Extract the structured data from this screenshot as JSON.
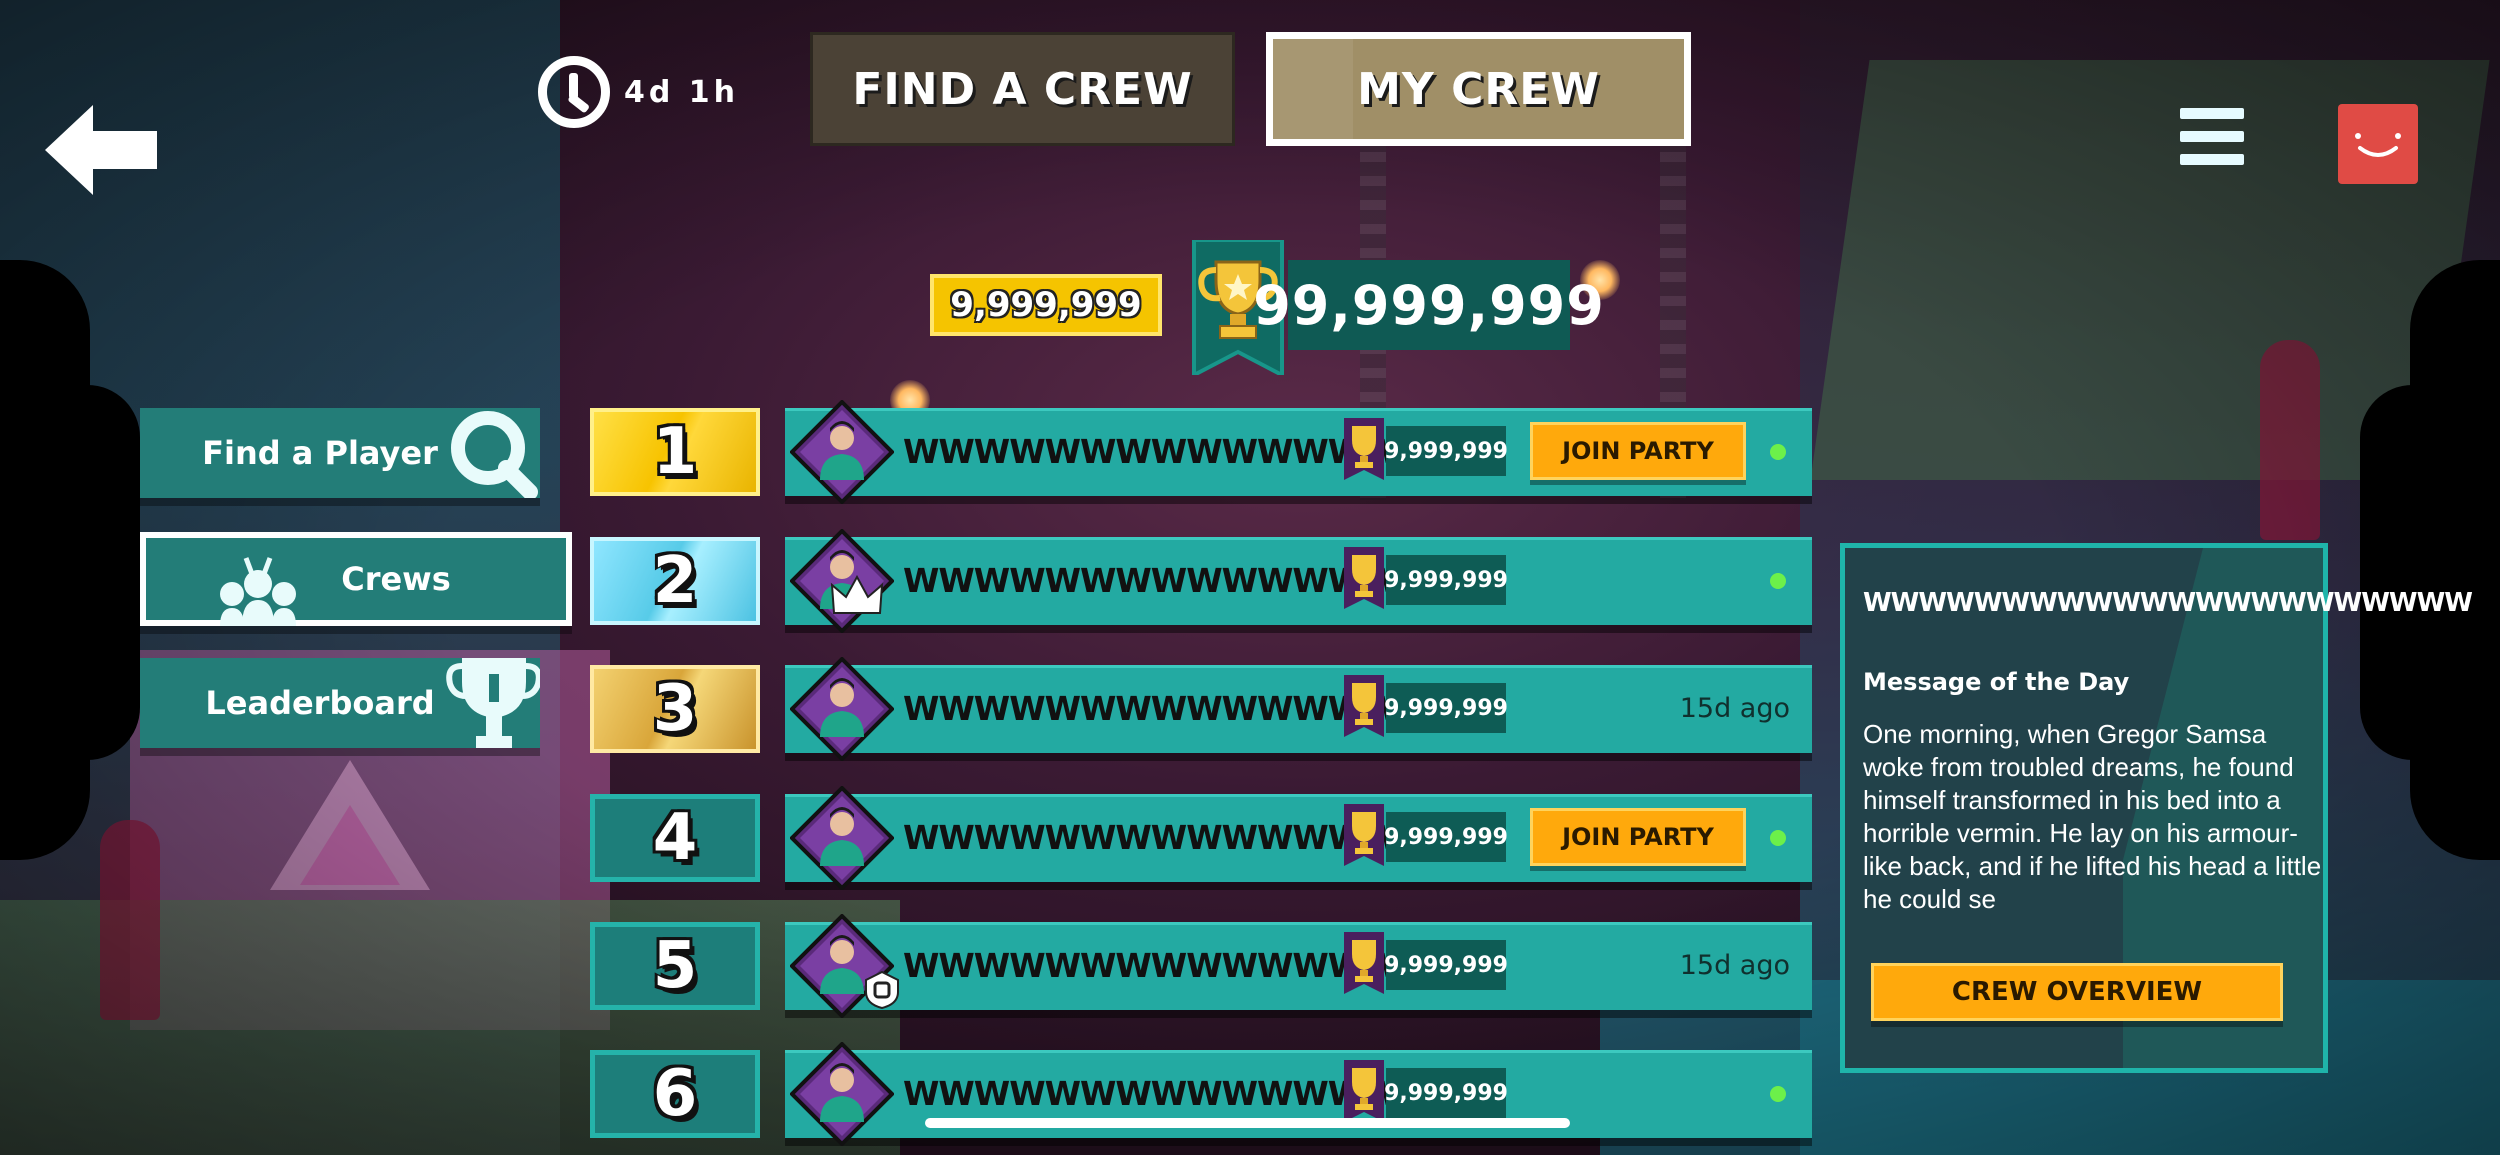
{
  "header": {
    "timer": "4d 1h",
    "tabs": [
      {
        "label": "FIND A CREW"
      },
      {
        "label": "MY CREW"
      }
    ]
  },
  "crew_summary": {
    "points": "9,999,999",
    "total_trophies": "99,999,999"
  },
  "nav": [
    {
      "label": "Find a Player",
      "icon": "search-icon"
    },
    {
      "label": "Crews",
      "icon": "crew-icon"
    },
    {
      "label": "Leaderboard",
      "icon": "trophy-icon"
    }
  ],
  "members": [
    {
      "rank": "1",
      "name": "WWWWWWWWWWWWWWWWW",
      "score": "9,999,999",
      "action": "JOIN PARTY",
      "status": "online"
    },
    {
      "rank": "2",
      "name": "WWWWWWWWWWWWWWWWW",
      "score": "9,999,999",
      "status": "online",
      "badge": "crown-icon"
    },
    {
      "rank": "3",
      "name": "WWWWWWWWWWWWWWWWW",
      "score": "9,999,999",
      "last_seen": "15d ago"
    },
    {
      "rank": "4",
      "name": "WWWWWWWWWWWWWWWWW",
      "score": "9,999,999",
      "action": "JOIN PARTY",
      "status": "online"
    },
    {
      "rank": "5",
      "name": "WWWWWWWWWWWWWWWWW",
      "score": "9,999,999",
      "last_seen": "15d ago",
      "badge": "shield-icon"
    },
    {
      "rank": "6",
      "name": "WWWWWWWWWWWWWWWWW",
      "score": "9,999,999",
      "status": "online"
    }
  ],
  "crew_panel": {
    "crew_name": "WWWWWWWWWWWWWWWWWWWWWW",
    "motd_title": "Message of the Day",
    "motd_body": "One morning, when Gregor Samsa woke from troubled dreams, he found himself transformed in his bed into a horrible vermin. He lay on his armour-like back, and if he lifted his head a little he could se",
    "button": "CREW OVERVIEW"
  },
  "colors": {
    "row_bar": "#23aaa2",
    "score_box": "#0e5c55",
    "join_button": "#ffa90c",
    "online": "#6cf04a",
    "gold": "#f7c300",
    "silver": "#57cbe8",
    "bronze": "#d9a63a"
  }
}
